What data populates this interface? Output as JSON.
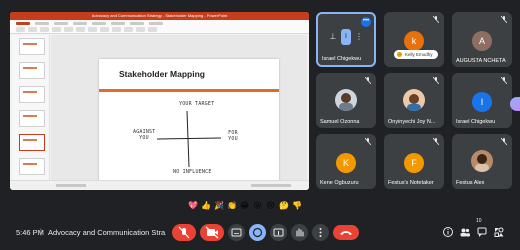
{
  "presentation": {
    "window_title": "Advocacy and Communication Strategy - Stakeholder Mapping - PowerPoint",
    "slide_title": "Stakeholder Mapping",
    "quadrant_top": "YOUR TARGET",
    "quadrant_left": "AGAINST YOU",
    "quadrant_right": "FOR YOU",
    "quadrant_bottom": "NO INFLUENCE"
  },
  "participants": [
    {
      "name": "Israel Chigekwu",
      "initial": "I",
      "color": "#1a73e8",
      "presenting": true
    },
    {
      "name": "Kelly Emodhy",
      "initial": "k",
      "color": "#e8710a"
    },
    {
      "name": "AUGUSTA NCHETA",
      "initial": "A",
      "color": "#8d6e63"
    },
    {
      "name": "Samuel Ozonna",
      "photo": true
    },
    {
      "name": "Onyinyechi Joy N...",
      "photo": true
    },
    {
      "name": "Israel Chigekwu",
      "initial": "I",
      "color": "#1a73e8"
    },
    {
      "name": "Kene Ogbuzuru",
      "initial": "K",
      "color": "#f29900"
    },
    {
      "name": "Festus's Notetaker",
      "initial": "F",
      "color": "#f29900"
    },
    {
      "name": "Festus Alex",
      "photo": true
    }
  ],
  "pill_label": "Kelly Emodhy",
  "meeting": {
    "time": "5:46 PM",
    "separator": "|",
    "title": "Advocacy and Communication Stra...",
    "participant_count": "10"
  },
  "reactions": [
    "💖",
    "👍",
    "🎉",
    "👏",
    "😂",
    "😮",
    "😢",
    "🤔",
    "👎"
  ],
  "icons": {
    "mic": "mic-off-icon",
    "camera": "camera-off-icon",
    "captions": "captions-icon",
    "present": "present-icon",
    "hand": "raise-hand-icon",
    "emoji": "emoji-icon",
    "more": "more-options-icon",
    "hangup": "hangup-icon"
  },
  "colors": {
    "background": "#202124",
    "tile": "#3c4043",
    "accent": "#8ab4f8",
    "danger": "#ea4335",
    "powerpoint": "#c43e1c"
  }
}
